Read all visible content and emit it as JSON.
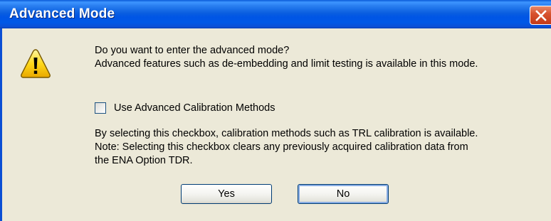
{
  "dialog": {
    "title": "Advanced Mode",
    "icon": "warning-icon",
    "message_line1": "Do you want to enter the advanced mode?",
    "message_line2": "Advanced features such as de-embedding and limit testing is available in this mode.",
    "checkbox": {
      "label": "Use Advanced Calibration Methods",
      "checked": false
    },
    "note_line1": "By selecting this checkbox, calibration methods such as TRL calibration is available.",
    "note_line2": "Note: Selecting this checkbox clears any previously acquired calibration data from",
    "note_line3": "the ENA Option TDR.",
    "buttons": {
      "yes_label": "Yes",
      "no_label": "No"
    }
  },
  "colors": {
    "titlebar": "#0058e6",
    "close_button": "#d8532f",
    "client_background": "#ece9d8"
  }
}
